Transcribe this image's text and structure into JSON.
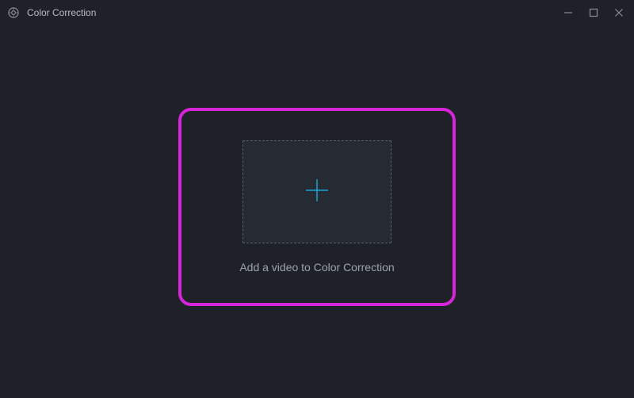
{
  "window": {
    "title": "Color Correction"
  },
  "main": {
    "helper_text": "Add a video to Color Correction"
  },
  "colors": {
    "accent": "#00a8e8",
    "highlight": "#d824d8"
  }
}
